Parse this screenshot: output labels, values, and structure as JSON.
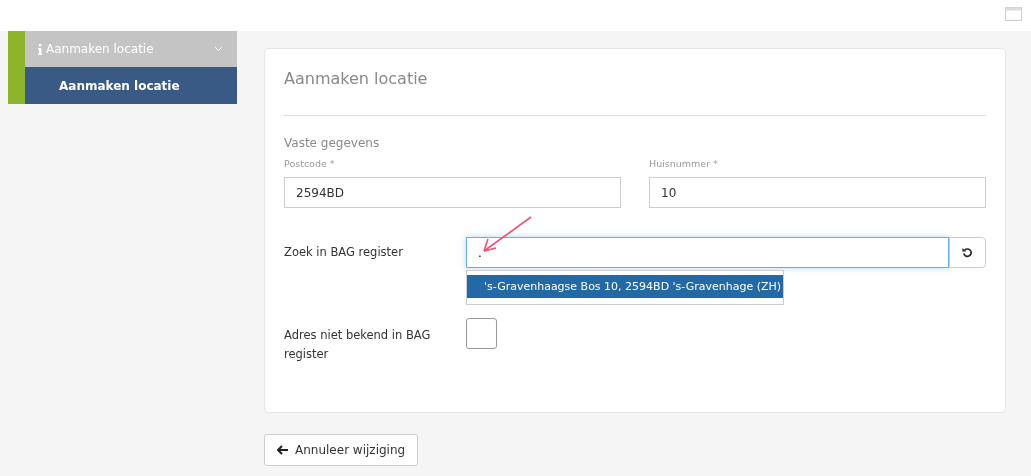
{
  "sidebar": {
    "header": {
      "label": "Aanmaken locatie",
      "expanded": true
    },
    "items": [
      {
        "label": "Aanmaken locatie",
        "selected": true
      }
    ]
  },
  "form": {
    "title": "Aanmaken locatie",
    "section": "Vaste gegevens",
    "postcode": {
      "label": "Postcode *",
      "value": "2594BD"
    },
    "huisnummer": {
      "label": "Huisnummer *",
      "value": "10"
    },
    "search": {
      "label": "Zoek in BAG register",
      "value": ".",
      "suggestions": [
        {
          "text": "'s-Gravenhaagse Bos 10, 2594BD 's-Gravenhage (ZH)",
          "selected": true
        }
      ]
    },
    "unknown": {
      "label": "Adres niet bekend in BAG register",
      "checked": false
    }
  },
  "cancel_button": "Annuleer wijziging"
}
